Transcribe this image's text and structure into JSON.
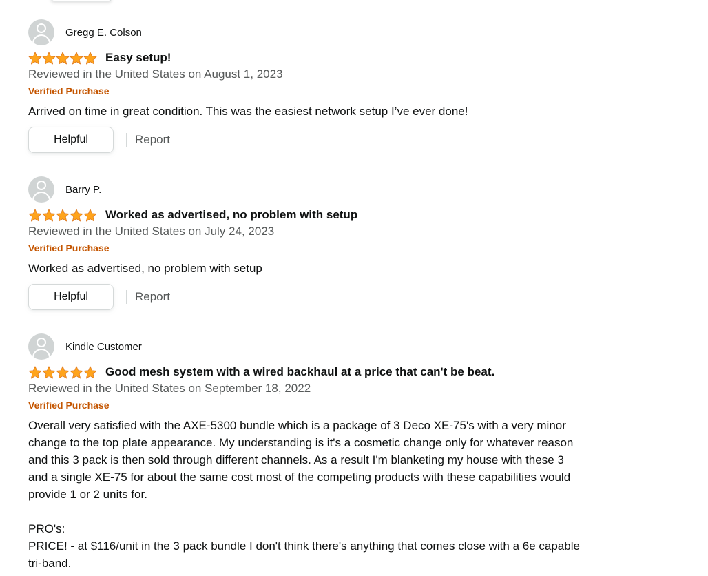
{
  "colors": {
    "star": "#ffa41c",
    "star_stroke": "#de7921",
    "verified": "#c45500",
    "muted_text": "#565959",
    "avatar_bg": "#d0d4d4"
  },
  "icons": {
    "avatar": "default-profile-avatar-icon",
    "star": "filled-star-icon"
  },
  "reviews": [
    {
      "name": "Gregg E. Colson",
      "rating": 5,
      "title": "Easy setup!",
      "date": "Reviewed in the United States on August 1, 2023",
      "verified": "Verified Purchase",
      "body": "Arrived on time in great condition. This was the easiest network setup I’ve ever done!",
      "helpful_label": "Helpful",
      "report_label": "Report"
    },
    {
      "name": "Barry P.",
      "rating": 5,
      "title": "Worked as advertised, no problem with setup",
      "date": "Reviewed in the United States on July 24, 2023",
      "verified": "Verified Purchase",
      "body": "Worked as advertised, no problem with setup",
      "helpful_label": "Helpful",
      "report_label": "Report"
    },
    {
      "name": "Kindle Customer",
      "rating": 5,
      "title": "Good mesh system with a wired backhaul at a price that can't be beat.",
      "date": "Reviewed in the United States on September 18, 2022",
      "verified": "Verified Purchase",
      "body": "Overall very satisfied with the AXE-5300 bundle which is a package of 3 Deco XE-75's with a very minor\nchange to the top plate appearance. My understanding is it's a cosmetic change only for whatever reason\nand this 3 pack is then sold through different channels. As a result I'm blanketing my house with these 3\nand a single XE-75 for about the same cost most of the competing products with these capabilities would\nprovide 1 or 2 units for.\n\nPRO's:\nPRICE! - at $116/unit in the 3 pack bundle I don't think there's anything that comes close with a 6e capable\ntri-band."
    }
  ]
}
